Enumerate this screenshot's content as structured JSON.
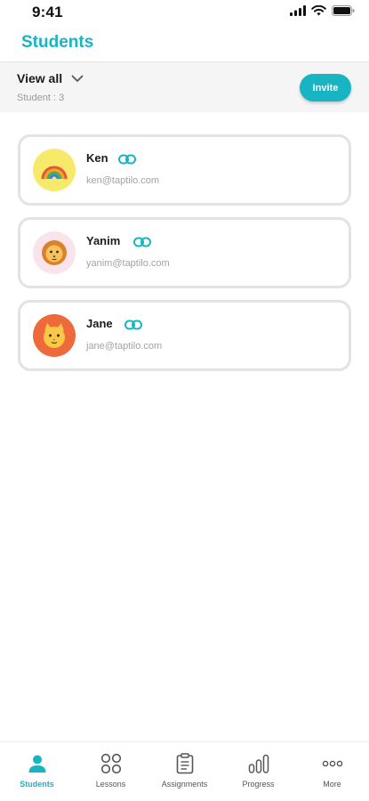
{
  "status_bar": {
    "time": "9:41"
  },
  "header": {
    "title": "Students"
  },
  "filter": {
    "view_label": "View all",
    "count_label": "Student : 3"
  },
  "invite": {
    "label": "Invite"
  },
  "students": [
    {
      "name": "Ken",
      "email": "ken@taptilo.com",
      "avatar": "rainbow-avatar-icon",
      "avatar_bg": "#f7ea6b"
    },
    {
      "name": "Yanim",
      "email": "yanim@taptilo.com",
      "avatar": "lion-avatar-icon",
      "avatar_bg": "#f8e4ea"
    },
    {
      "name": "Jane",
      "email": "jane@taptilo.com",
      "avatar": "cat-avatar-icon",
      "avatar_bg": "#ee6a3b"
    }
  ],
  "tabs": [
    {
      "label": "Students",
      "icon": "person-icon",
      "active": true
    },
    {
      "label": "Lessons",
      "icon": "four-circles-icon",
      "active": false
    },
    {
      "label": "Assignments",
      "icon": "clipboard-icon",
      "active": false
    },
    {
      "label": "Progress",
      "icon": "bar-chart-icon",
      "active": false
    },
    {
      "label": "More",
      "icon": "ellipsis-icon",
      "active": false
    }
  ],
  "colors": {
    "accent": "#17b4c4",
    "card_border": "#e3e3e3",
    "filter_bg": "#f5f5f5",
    "muted_text": "#a3a3a3"
  }
}
